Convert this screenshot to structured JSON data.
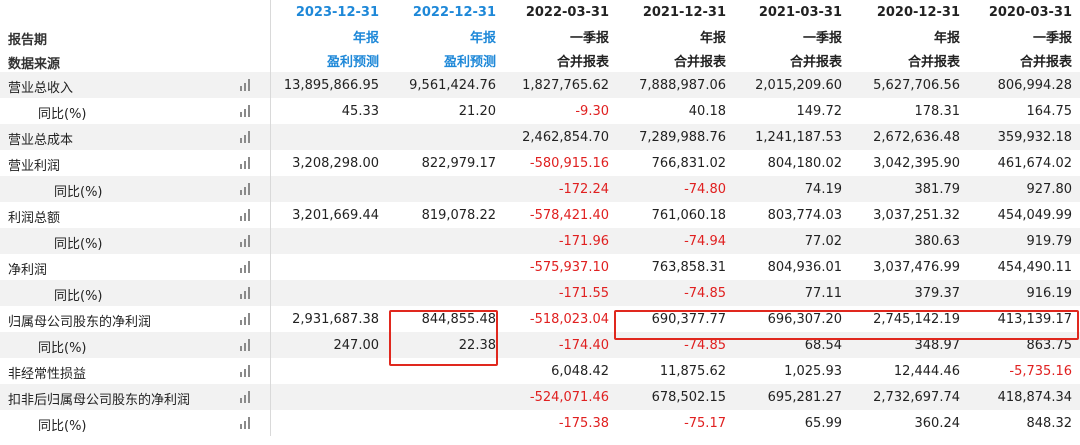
{
  "header": {
    "row_label": "报告期",
    "source_label": "数据来源",
    "columns": [
      {
        "date": "2023-12-31",
        "type": "年报",
        "source": "盈利预测",
        "forecast": true
      },
      {
        "date": "2022-12-31",
        "type": "年报",
        "source": "盈利预测",
        "forecast": true
      },
      {
        "date": "2022-03-31",
        "type": "一季报",
        "source": "合并报表",
        "forecast": false
      },
      {
        "date": "2021-12-31",
        "type": "年报",
        "source": "合并报表",
        "forecast": false
      },
      {
        "date": "2021-03-31",
        "type": "一季报",
        "source": "合并报表",
        "forecast": false
      },
      {
        "date": "2020-12-31",
        "type": "年报",
        "source": "合并报表",
        "forecast": false
      },
      {
        "date": "2020-03-31",
        "type": "一季报",
        "source": "合并报表",
        "forecast": false
      }
    ]
  },
  "rows": [
    {
      "label": "营业总收入",
      "indent": 1,
      "values": [
        "13,895,866.95",
        "9,561,424.76",
        "1,827,765.62",
        "7,888,987.06",
        "2,015,209.60",
        "5,627,706.56",
        "806,994.28"
      ]
    },
    {
      "label": "同比(%)",
      "indent": 2,
      "values": [
        "45.33",
        "21.20",
        "-9.30",
        "40.18",
        "149.72",
        "178.31",
        "164.75"
      ]
    },
    {
      "label": "营业总成本",
      "indent": 1,
      "values": [
        "",
        "",
        "2,462,854.70",
        "7,289,988.76",
        "1,241,187.53",
        "2,672,636.48",
        "359,932.18"
      ]
    },
    {
      "label": "营业利润",
      "indent": 1,
      "values": [
        "3,208,298.00",
        "822,979.17",
        "-580,915.16",
        "766,831.02",
        "804,180.02",
        "3,042,395.90",
        "461,674.02"
      ]
    },
    {
      "label": "同比(%)",
      "indent": 3,
      "values": [
        "",
        "",
        "-172.24",
        "-74.80",
        "74.19",
        "381.79",
        "927.80"
      ]
    },
    {
      "label": "利润总额",
      "indent": 1,
      "values": [
        "3,201,669.44",
        "819,078.22",
        "-578,421.40",
        "761,060.18",
        "803,774.03",
        "3,037,251.32",
        "454,049.99"
      ]
    },
    {
      "label": "同比(%)",
      "indent": 3,
      "values": [
        "",
        "",
        "-171.96",
        "-74.94",
        "77.02",
        "380.63",
        "919.79"
      ]
    },
    {
      "label": "净利润",
      "indent": 1,
      "values": [
        "",
        "",
        "-575,937.10",
        "763,858.31",
        "804,936.01",
        "3,037,476.99",
        "454,490.11"
      ]
    },
    {
      "label": "同比(%)",
      "indent": 3,
      "values": [
        "",
        "",
        "-171.55",
        "-74.85",
        "77.11",
        "379.37",
        "916.19"
      ]
    },
    {
      "label": "归属母公司股东的净利润",
      "indent": 1,
      "values": [
        "2,931,687.38",
        "844,855.48",
        "-518,023.04",
        "690,377.77",
        "696,307.20",
        "2,745,142.19",
        "413,139.17"
      ]
    },
    {
      "label": "同比(%)",
      "indent": 2,
      "values": [
        "247.00",
        "22.38",
        "-174.40",
        "-74.85",
        "68.54",
        "348.97",
        "863.75"
      ]
    },
    {
      "label": "非经常性损益",
      "indent": 1,
      "values": [
        "",
        "",
        "6,048.42",
        "11,875.62",
        "1,025.93",
        "12,444.46",
        "-5,735.16"
      ]
    },
    {
      "label": "扣非后归属母公司股东的净利润",
      "indent": 1,
      "values": [
        "",
        "",
        "-524,071.46",
        "678,502.15",
        "695,281.27",
        "2,732,697.74",
        "418,874.34"
      ]
    },
    {
      "label": "同比(%)",
      "indent": 2,
      "values": [
        "",
        "",
        "-175.38",
        "-75.17",
        "65.99",
        "360.24",
        "848.32"
      ]
    }
  ],
  "highlights": [
    {
      "name": "forecast-2022-net-profit-highlight",
      "covers": "2022-12-31 归属母公司股东的净利润 and 同比(%)"
    },
    {
      "name": "historical-net-profit-highlight",
      "covers": "2021-12-31 to 2020-03-31 归属母公司股东的净利润"
    }
  ],
  "colors": {
    "forecast_header": "#1e88d8",
    "negative": "#e02020",
    "highlight_border": "#e0281e",
    "band": "#f2f2f2"
  },
  "icons": {
    "row_chart": "bar-chart-icon"
  }
}
